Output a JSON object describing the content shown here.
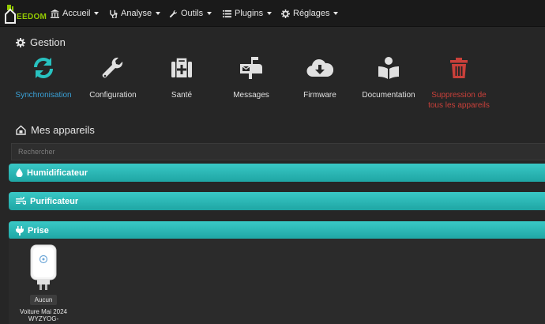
{
  "navbar": {
    "brand": "EEDOM",
    "items": [
      {
        "label": "Accueil",
        "icon": "bank-icon"
      },
      {
        "label": "Analyse",
        "icon": "stethoscope-icon"
      },
      {
        "label": "Outils",
        "icon": "wrench-icon"
      },
      {
        "label": "Plugins",
        "icon": "list-icon"
      },
      {
        "label": "Réglages",
        "icon": "gears-icon"
      }
    ]
  },
  "gestion": {
    "title": "Gestion",
    "tiles": [
      {
        "label": "Synchronisation",
        "icon": "sync-icon",
        "color": "#28c2c0"
      },
      {
        "label": "Configuration",
        "icon": "wrench-icon",
        "color": "#e0e0e0"
      },
      {
        "label": "Santé",
        "icon": "medkit-icon",
        "color": "#e0e0e0"
      },
      {
        "label": "Messages",
        "icon": "mailbox-icon",
        "color": "#e0e0e0"
      },
      {
        "label": "Firmware",
        "icon": "cloud-download-icon",
        "color": "#e0e0e0"
      },
      {
        "label": "Documentation",
        "icon": "book-reader-icon",
        "color": "#e0e0e0"
      },
      {
        "label_line1": "Suppression de",
        "label_line2": "tous les appareils",
        "icon": "trash-icon",
        "color": "#c9403a"
      }
    ]
  },
  "devices": {
    "title": "Mes appareils",
    "search_placeholder": "Rechercher",
    "groups": [
      {
        "label": "Humidificateur",
        "icon": "tint-icon"
      },
      {
        "label": "Purificateur",
        "icon": "wind-icon"
      },
      {
        "label": "Prise",
        "icon": "plug-icon"
      }
    ],
    "items": [
      {
        "badge": "Aucun",
        "name_line1": "Voiture Mai 2024",
        "name_line2": "WYZYOG-"
      }
    ]
  },
  "colors": {
    "accent": "#28c2c0",
    "danger": "#c9403a",
    "sync_text": "#3aa0d6",
    "brand": "#94ca02"
  }
}
